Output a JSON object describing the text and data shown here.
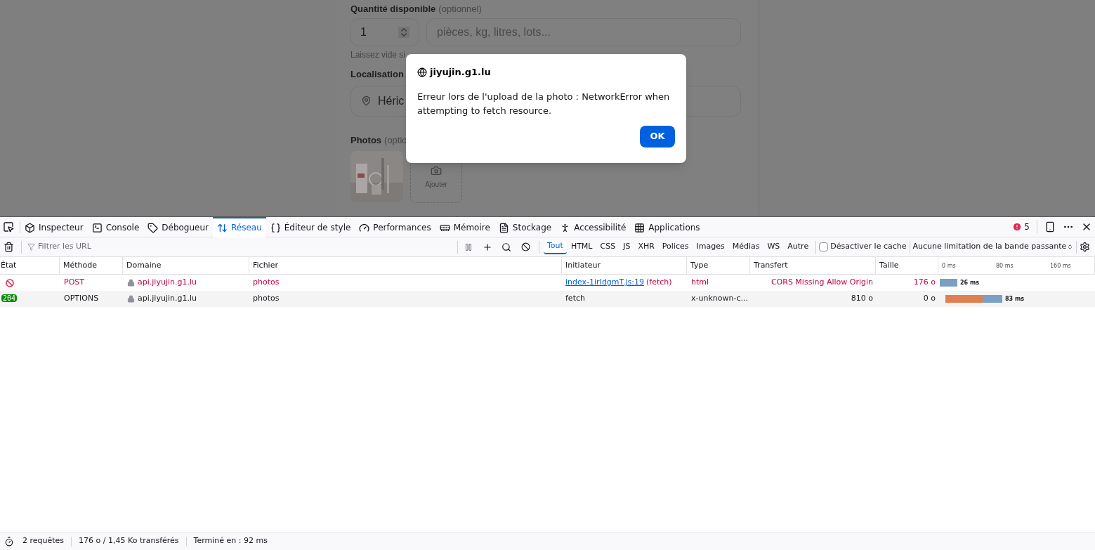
{
  "page": {
    "quantity_label": "Quantité disponible",
    "quantity_optional": "(optionnel)",
    "quantity_value": "1",
    "unit_placeholder": "pièces, kg, litres, lots...",
    "hint": "Laissez vide si",
    "location_label": "Localisation",
    "location_value": "Héric",
    "photos_label": "Photos",
    "photos_optional": "(optio",
    "add_photo_label": "Ajouter"
  },
  "dialog": {
    "origin": "jiyujin.g1.lu",
    "message": "Erreur lors de l'upload de la photo : NetworkError when attempting to fetch resource.",
    "button": "OK"
  },
  "devtools": {
    "tabs": [
      {
        "label": "Inspecteur",
        "selected": false
      },
      {
        "label": "Console",
        "selected": false
      },
      {
        "label": "Débogueur",
        "selected": false
      },
      {
        "label": "Réseau",
        "selected": true
      },
      {
        "label": "Éditeur de style",
        "selected": false
      },
      {
        "label": "Performances",
        "selected": false
      },
      {
        "label": "Mémoire",
        "selected": false
      },
      {
        "label": "Stockage",
        "selected": false
      },
      {
        "label": "Accessibilité",
        "selected": false
      },
      {
        "label": "Applications",
        "selected": false
      }
    ],
    "error_count": "5",
    "filter_placeholder": "Filtrer les URL",
    "type_filters": [
      {
        "label": "Tout",
        "selected": true
      },
      {
        "label": "HTML",
        "selected": false
      },
      {
        "label": "CSS",
        "selected": false
      },
      {
        "label": "JS",
        "selected": false
      },
      {
        "label": "XHR",
        "selected": false
      },
      {
        "label": "Polices",
        "selected": false
      },
      {
        "label": "Images",
        "selected": false
      },
      {
        "label": "Médias",
        "selected": false
      },
      {
        "label": "WS",
        "selected": false
      },
      {
        "label": "Autre",
        "selected": false
      }
    ],
    "disable_cache": {
      "label": "Désactiver le cache",
      "checked": false
    },
    "throttling": "Aucune limitation de la bande passante",
    "columns": [
      "État",
      "Méthode",
      "Domaine",
      "Fichier",
      "Initiateur",
      "Type",
      "Transfert",
      "Taille"
    ],
    "timeline_ticks": [
      "0 ms",
      "80 ms",
      "160 ms"
    ],
    "rows": [
      {
        "kind": "blocked",
        "error": true,
        "method": "POST",
        "domain": "api.jiyujin.g1.lu",
        "file": "photos",
        "initiator_link": "index-1irIdgmT.js:19",
        "initiator": "(fetch)",
        "type": "html",
        "transfer": "CORS Missing Allow Origin",
        "size": "176 o",
        "timing": "26 ms"
      },
      {
        "kind": "ok",
        "status": "204",
        "error": false,
        "method": "OPTIONS",
        "domain": "api.jiyujin.g1.lu",
        "file": "photos",
        "initiator": "fetch",
        "type": "x-unknown-c...",
        "transfer": "810 o",
        "size": "0 o",
        "timing": "83 ms"
      }
    ],
    "status_bar": [
      "2 requêtes",
      "176 o / 1,45 Ko transférés",
      "Terminé en : 92 ms"
    ]
  }
}
